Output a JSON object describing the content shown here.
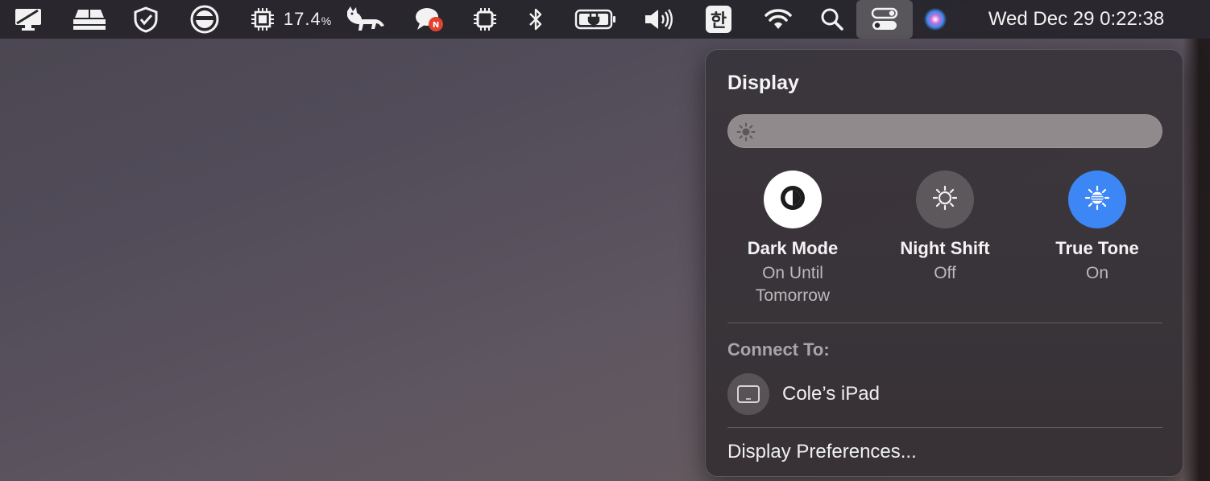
{
  "menubar": {
    "cpu_percent": "17.4",
    "cpu_unit": "%",
    "input_method": "한",
    "clock": "Wed Dec 29  0:22:38",
    "icons": [
      "display-icon",
      "keyboard-icon",
      "shield-check-icon",
      "avatar-icon",
      "cpu-chip-icon",
      "runcat-icon",
      "chat-bubble-icon",
      "chip-icon",
      "bluetooth-icon",
      "battery-charging-icon",
      "volume-icon",
      "input-method-icon",
      "wifi-icon",
      "search-icon",
      "control-center-icon",
      "siri-icon"
    ]
  },
  "display_panel": {
    "title": "Display",
    "brightness": 1.0,
    "toggles": [
      {
        "label": "Dark Mode",
        "status_line1": "On Until",
        "status_line2": "Tomorrow",
        "icon": "dark-mode-icon",
        "state": "on",
        "bg": "#ffffff"
      },
      {
        "label": "Night Shift",
        "status_line1": "Off",
        "status_line2": "",
        "icon": "night-shift-icon",
        "state": "off",
        "bg": "#5d585b"
      },
      {
        "label": "True Tone",
        "status_line1": "On",
        "status_line2": "",
        "icon": "true-tone-icon",
        "state": "on",
        "bg": "#3d86f5"
      }
    ],
    "connect_label": "Connect To:",
    "device_name": "Cole’s iPad",
    "preferences_label": "Display Preferences..."
  },
  "colors": {
    "accent": "#3d86f5",
    "menubar_bg": "#26242a",
    "panel_bg": "#3a363c"
  }
}
